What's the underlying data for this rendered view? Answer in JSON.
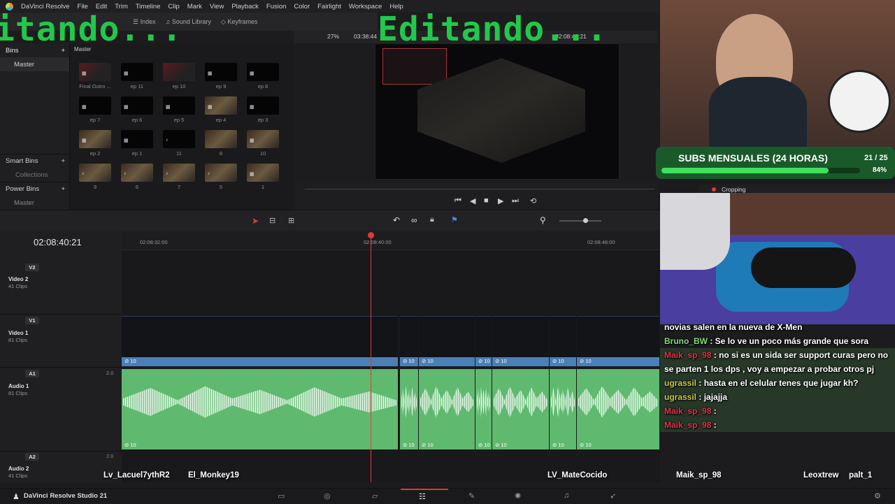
{
  "menu": [
    "DaVinci Resolve",
    "File",
    "Edit",
    "Trim",
    "Timeline",
    "Clip",
    "Mark",
    "View",
    "Playback",
    "Fusion",
    "Color",
    "Fairlight",
    "Workspace",
    "Help"
  ],
  "toolbar": {
    "index": "Index",
    "sound_library": "Sound Library",
    "keyframes": "Keyframes"
  },
  "overlay": {
    "left_text": "itando...",
    "main_text": "Editando..."
  },
  "bins": {
    "header": "Bins",
    "master": "Master",
    "smart_bins": "Smart Bins",
    "collections": "Collections",
    "power_bins": "Power Bins",
    "power_master": "Master"
  },
  "mediapool": {
    "breadcrumb": "Master",
    "clips": [
      {
        "label": "Final Outro ..."
      },
      {
        "label": "ep 11"
      },
      {
        "label": "ep 10"
      },
      {
        "label": "ep 9"
      },
      {
        "label": "ep 8"
      },
      {
        "label": "ep 7"
      },
      {
        "label": "ep 6"
      },
      {
        "label": "ep 5"
      },
      {
        "label": "ep 4"
      },
      {
        "label": "ep 3"
      },
      {
        "label": "ep 2"
      },
      {
        "label": "ep 1"
      },
      {
        "label": "11"
      },
      {
        "label": "8"
      },
      {
        "label": "10"
      },
      {
        "label": "9"
      },
      {
        "label": "6"
      },
      {
        "label": "7"
      },
      {
        "label": "5"
      },
      {
        "label": "1"
      }
    ]
  },
  "viewer": {
    "zoom": "27%",
    "timecode_left": "03:38:44",
    "timecode_right": "02:08:40:21"
  },
  "timeline": {
    "current_timecode": "02:08:40:21",
    "ruler": [
      "02:08:32:00",
      "02:08:40:00",
      "02:08:48:00"
    ],
    "tracks": [
      {
        "tag": "V2",
        "name": "Video 2",
        "clips": "41 Clips"
      },
      {
        "tag": "V1",
        "name": "Video 1",
        "clips": "81 Clips"
      },
      {
        "tag": "A1",
        "name": "Audio 1",
        "clips": "81 Clips",
        "vol": "2.0"
      },
      {
        "tag": "A2",
        "name": "Audio 2",
        "clips": "41 Clips",
        "vol": "2.0"
      }
    ],
    "clip_label": "10"
  },
  "subs": {
    "title": "SUBS MENSUALES (24 HORAS)",
    "count": "21 / 25",
    "percent": "84%",
    "progress": 0.84
  },
  "crop": {
    "label": "Cropping"
  },
  "chat": [
    {
      "user": "",
      "text": "novias salen en la nueva de X-Men",
      "color": "#ffffff"
    },
    {
      "user": "Bruno_BW",
      "text": "Se lo ve un poco más grande que sora",
      "color": "#7be07b"
    },
    {
      "user": "Maik_sp_98",
      "text": "no si es un sida ser support curas pero no se parten 1 los dps , voy a empezar a probar otros pj",
      "color": "#e0334a"
    },
    {
      "user": "ugrassil",
      "text": "hasta en el celular tenes que jugar kh?",
      "color": "#c8c84a"
    },
    {
      "user": "ugrassil",
      "text": "jajajja",
      "color": "#c8c84a"
    },
    {
      "user": "Maik_sp_98",
      "text": "",
      "color": "#e0334a"
    },
    {
      "user": "Maik_sp_98",
      "text": "",
      "color": "#e0334a"
    }
  ],
  "names": [
    "Lv_Lacuel7ythR2",
    "El_Monkey19",
    "LV_MateCocido",
    "Maik_sp_98",
    "Leoxtrew",
    "palt_1"
  ],
  "pagebar": {
    "app": "DaVinci Resolve Studio 21"
  },
  "colors": {
    "overlay": "#22c84a",
    "playhead": "#e03a3a",
    "video_clip": "#4a7fb8",
    "audio_clip": "#5fba6f"
  }
}
